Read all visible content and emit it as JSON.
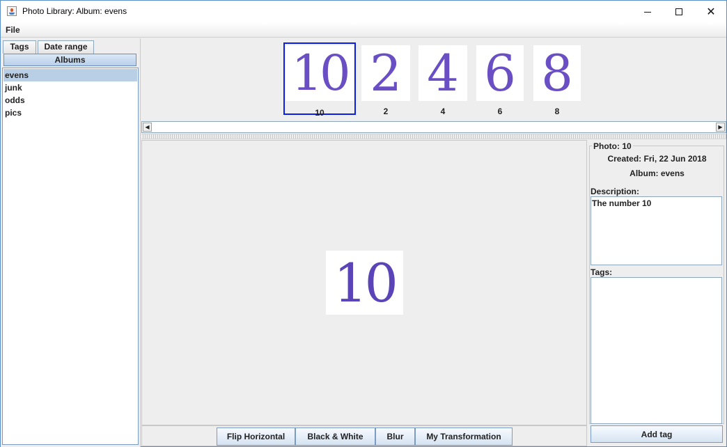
{
  "window": {
    "title": "Photo Library: Album: evens",
    "controls": {
      "minimize": "minimize-icon",
      "maximize": "maximize-icon",
      "close": "✕"
    }
  },
  "menu": {
    "file": "File"
  },
  "left_panel": {
    "tabs": [
      {
        "label": "Tags"
      },
      {
        "label": "Date range"
      },
      {
        "label": "Albums",
        "selected": true
      }
    ],
    "albums": [
      "evens",
      "junk",
      "odds",
      "pics"
    ],
    "selected_album": "evens"
  },
  "thumbnails": [
    {
      "label": "10",
      "image_text": "10",
      "selected": true
    },
    {
      "label": "2",
      "image_text": "2",
      "selected": false
    },
    {
      "label": "4",
      "image_text": "4",
      "selected": false
    },
    {
      "label": "6",
      "image_text": "6",
      "selected": false
    },
    {
      "label": "8",
      "image_text": "8",
      "selected": false
    }
  ],
  "viewer": {
    "image_text": "10",
    "buttons": [
      "Flip Horizontal",
      "Black & White",
      "Blur",
      "My Transformation"
    ]
  },
  "info": {
    "legend": "Photo: 10",
    "created": "Created: Fri, 22 Jun 2018",
    "album": "Album: evens",
    "description_label": "Description:",
    "description": "The number 10",
    "tags_label": "Tags:",
    "tags": "",
    "add_tag": "Add tag"
  },
  "colors": {
    "accent": "#0a1ee8",
    "selection": "#b8cfe5",
    "image_ink": "#5b43b8"
  }
}
